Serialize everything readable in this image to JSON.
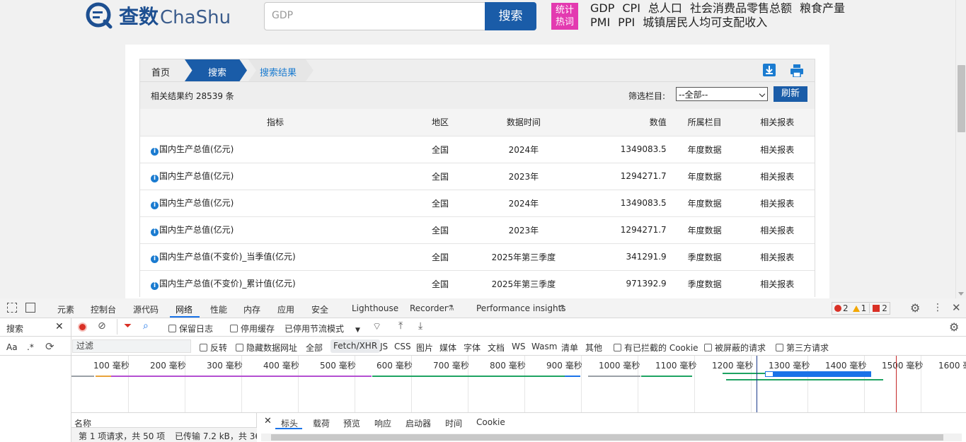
{
  "site": {
    "logo_main": "查数",
    "logo_sub": "ChaShu",
    "search_placeholder": "GDP",
    "search_button": "搜索",
    "hot_badge_line1": "统计",
    "hot_badge_line2": "热词",
    "hot_words": [
      "GDP",
      "CPI",
      "总人口",
      "社会消费品零售总额",
      "粮食产量",
      "PMI",
      "PPI",
      "城镇居民人均可支配收入"
    ]
  },
  "breadcrumb": {
    "home": "首页",
    "search": "搜索",
    "result": "搜索结果"
  },
  "toolbar": {
    "result_count": "相关结果约 28539 条",
    "filter_label": "筛选栏目:",
    "filter_value": "--全部--",
    "refresh": "刷新"
  },
  "table": {
    "headers": [
      "指标",
      "地区",
      "数据时间",
      "数值",
      "所属栏目",
      "相关报表"
    ],
    "rows": [
      {
        "name": "国内生产总值(亿元)",
        "region": "全国",
        "time": "2024年",
        "value": "1349083.5",
        "category": "年度数据",
        "related": "相关报表"
      },
      {
        "name": "国内生产总值(亿元)",
        "region": "全国",
        "time": "2023年",
        "value": "1294271.7",
        "category": "年度数据",
        "related": "相关报表"
      },
      {
        "name": "国内生产总值(亿元)",
        "region": "全国",
        "time": "2024年",
        "value": "1349083.5",
        "category": "年度数据",
        "related": "相关报表"
      },
      {
        "name": "国内生产总值(亿元)",
        "region": "全国",
        "time": "2023年",
        "value": "1294271.7",
        "category": "年度数据",
        "related": "相关报表"
      },
      {
        "name": "国内生产总值(不变价)_当季值(亿元)",
        "region": "全国",
        "time": "2025年第三季度",
        "value": "341291.9",
        "category": "季度数据",
        "related": "相关报表"
      },
      {
        "name": "国内生产总值(不变价)_累计值(亿元)",
        "region": "全国",
        "time": "2025年第三季度",
        "value": "971392.9",
        "category": "季度数据",
        "related": "相关报表"
      }
    ]
  },
  "devtools": {
    "tabs": [
      "元素",
      "控制台",
      "源代码",
      "网络",
      "性能",
      "内存",
      "应用",
      "安全",
      "Lighthouse",
      "Recorder",
      "Performance insights"
    ],
    "active_tab": "网络",
    "errors": "2",
    "warnings": "1",
    "issues": "2",
    "left_panel_title": "搜索",
    "preserve_log": "保留日志",
    "disable_cache": "停用缓存",
    "throttle": "已停用节流模式",
    "case_label": "Aa",
    "regex_label": ".*",
    "filter_placeholder": "过滤",
    "invert": "反转",
    "hide_data_urls": "隐藏数据网址",
    "type_filters": [
      "全部",
      "Fetch/XHR",
      "JS",
      "CSS",
      "图片",
      "媒体",
      "字体",
      "文档",
      "WS",
      "Wasm",
      "清单",
      "其他"
    ],
    "blocked_cookies": "有已拦截的 Cookie",
    "blocked_requests": "被屏蔽的请求",
    "third_party": "第三方请求",
    "timeline_labels": [
      "100 毫秒",
      "200 毫秒",
      "300 毫秒",
      "400 毫秒",
      "500 毫秒",
      "600 毫秒",
      "700 毫秒",
      "800 毫秒",
      "900 毫秒",
      "1000 毫秒",
      "1100 毫秒",
      "1200 毫秒",
      "1300 毫秒",
      "1400 毫秒",
      "1500 毫秒",
      "1600 毫"
    ],
    "name_col": "名称",
    "detail_tabs": [
      "标头",
      "载荷",
      "预览",
      "响应",
      "启动器",
      "时间",
      "Cookie"
    ],
    "status": "第 1 项请求，共 50 项",
    "transferred": "已传输 7.2 kB，共 36"
  },
  "colors": {
    "brand_blue": "#1a5ca8",
    "hot_pink": "#e33ab0",
    "link_blue": "#1a7bd0"
  }
}
